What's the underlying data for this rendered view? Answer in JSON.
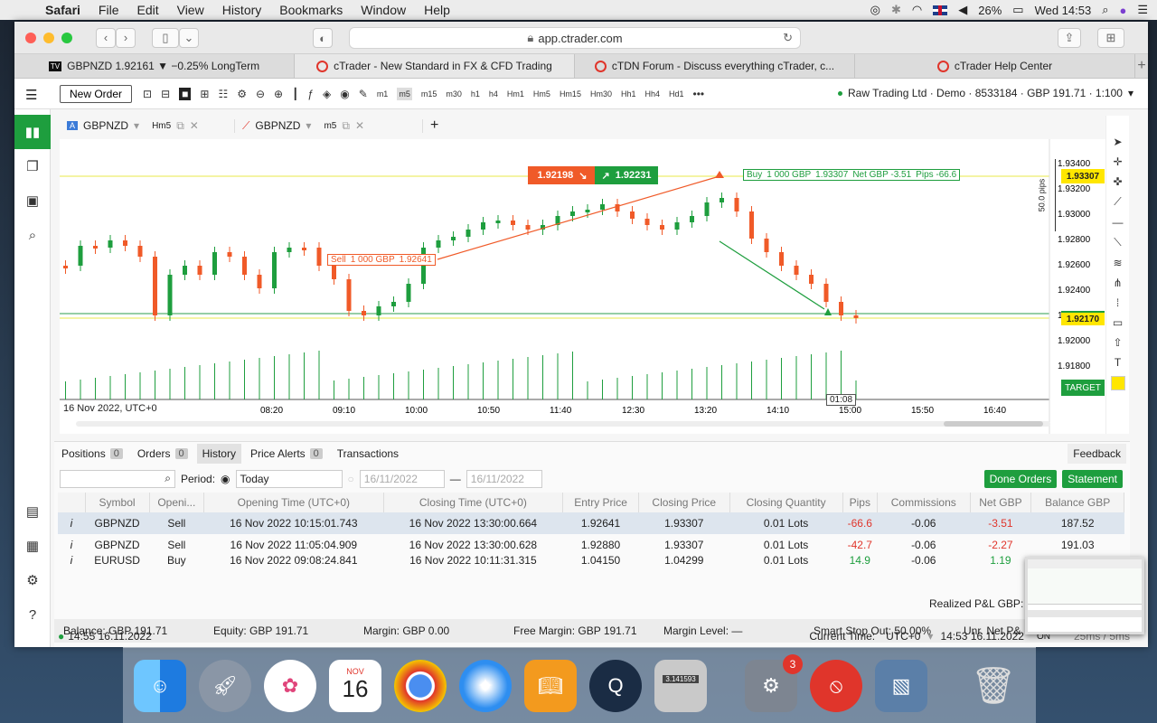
{
  "menubar": {
    "app": "Safari",
    "items": [
      "File",
      "Edit",
      "View",
      "History",
      "Bookmarks",
      "Window",
      "Help"
    ],
    "battery": "26%",
    "clock": "Wed 14:53"
  },
  "browser": {
    "url": "app.ctrader.com",
    "tabs": [
      {
        "label": "GBPNZD 1.92161 ▼ −0.25% LongTerm"
      },
      {
        "label": "cTrader - New Standard in FX & CFD Trading"
      },
      {
        "label": "cTDN Forum - Discuss everything cTrader, c..."
      },
      {
        "label": "cTrader Help Center"
      }
    ]
  },
  "toolbar": {
    "new_order": "New Order",
    "timeframes": [
      "m1",
      "m5",
      "m15",
      "m30",
      "h1",
      "h4",
      "Hm1",
      "Hm5",
      "Hm15",
      "Hm30",
      "Hh1",
      "Hh4",
      "Hd1"
    ],
    "more": "•••",
    "account": "Raw Trading Ltd · Demo · 8533184 · GBP 191.71 · 1:100"
  },
  "chart_tabs": [
    {
      "symbol": "GBPNZD",
      "tf": "Hm5"
    },
    {
      "symbol": "GBPNZD",
      "tf": "m5"
    }
  ],
  "chart": {
    "sell_price": "1.92198",
    "buy_price": "1.92231",
    "buy_label": "Buy",
    "buy_qty": "1 000 GBP",
    "buy_entry": "1.93307",
    "buy_net": "Net GBP -3.51",
    "buy_pips": "Pips -66.6",
    "sell_label": "Sell",
    "sell_qty": "1 000 GBP",
    "sell_entry": "1.92641",
    "ruler": "50.0 pips",
    "price_tag_top": "1.93307",
    "price_tag_current": "1.92170",
    "target": "TARGET",
    "countdown": "01:08",
    "date_label": "16 Nov 2022, UTC+0",
    "y_ticks": [
      "1.93400",
      "1.93200",
      "1.93000",
      "1.92800",
      "1.92600",
      "1.92400",
      "1.92200",
      "1.92000",
      "1.91800"
    ],
    "x_ticks": [
      "08:20",
      "09:10",
      "10:00",
      "10:50",
      "11:40",
      "12:30",
      "13:20",
      "14:10",
      "15:00",
      "15:50",
      "16:40"
    ]
  },
  "panel": {
    "tabs": [
      {
        "label": "Positions",
        "count": "0"
      },
      {
        "label": "Orders",
        "count": "0"
      },
      {
        "label": "History"
      },
      {
        "label": "Price Alerts",
        "count": "0"
      },
      {
        "label": "Transactions"
      }
    ],
    "feedback": "Feedback",
    "period_label": "Period:",
    "period_value": "Today",
    "date_from": "16/11/2022",
    "date_to": "16/11/2022",
    "done_orders": "Done Orders",
    "statement": "Statement",
    "columns": [
      "Symbol",
      "Openi...",
      "Opening Time (UTC+0)",
      "Closing Time (UTC+0)",
      "Entry Price",
      "Closing Price",
      "Closing Quantity",
      "Pips",
      "Commissions",
      "Net GBP",
      "Balance GBP"
    ],
    "rows": [
      [
        "GBPNZD",
        "Sell",
        "16 Nov 2022 10:15:01.743",
        "16 Nov 2022 13:30:00.664",
        "1.92641",
        "1.93307",
        "0.01 Lots",
        "-66.6",
        "-0.06",
        "-3.51",
        "187.52"
      ],
      [
        "GBPNZD",
        "Sell",
        "16 Nov 2022 11:05:04.909",
        "16 Nov 2022 13:30:00.628",
        "1.92880",
        "1.93307",
        "0.01 Lots",
        "-42.7",
        "-0.06",
        "-2.27",
        "191.03"
      ],
      [
        "EURUSD",
        "Buy",
        "16 Nov 2022 09:08:24.841",
        "16 Nov 2022 10:11:31.315",
        "1.04150",
        "1.04299",
        "0.01 Lots",
        "14.9",
        "-0.06",
        "1.19",
        ""
      ]
    ],
    "realized": "Realized P&L GBP:",
    "summary": [
      "Balance:  GBP 191.71",
      "Equity:  GBP 191.71",
      "Margin:  GBP 0.00",
      "Free Margin:  GBP 191.71",
      "Margin Level:  —",
      "Smart Stop Out:  50.00%",
      "Unr. Net P&"
    ]
  },
  "status": {
    "left": "14:55 16.11.2022",
    "current_time_label": "Current Time:",
    "tz": "UTC+0",
    "time": "14:53 16.11.2022",
    "on": "ON",
    "latency": "25ms / 5ms"
  },
  "dock": {
    "calendar_month": "NOV",
    "calendar_day": "16",
    "badge": "3",
    "calc": "3.141593"
  },
  "colors": {
    "green": "#1e9e3e",
    "red": "#f05a28",
    "accent": "#1e9e3e"
  }
}
